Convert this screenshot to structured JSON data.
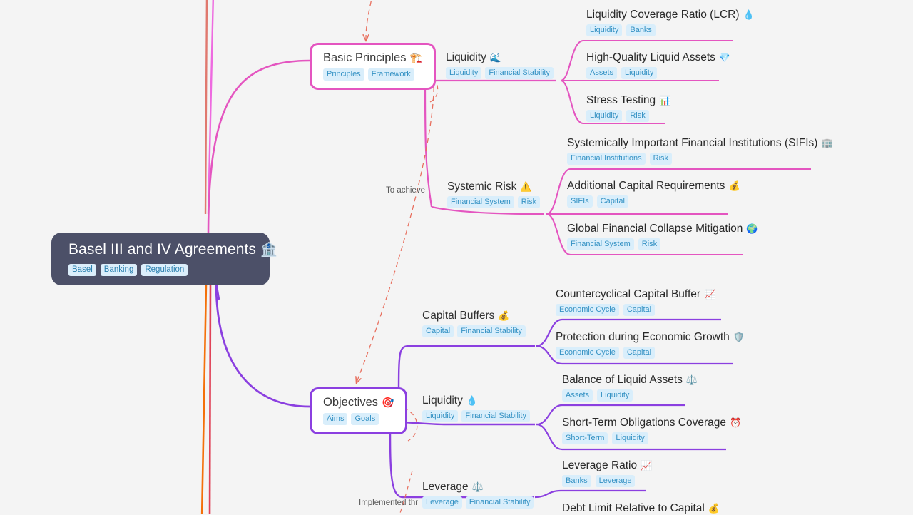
{
  "colors": {
    "background": "#f4f4f4",
    "root_bg": "#4c5068",
    "branch_pink": "#e455c0",
    "branch_purple": "#8b3fe0",
    "tag_bg": "#d9eefb",
    "tag_text": "#3592c4",
    "relation_dashed": "#e8705f",
    "trunk_orange": "#f4700a",
    "trunk_red": "#e04257",
    "trunk_salmon": "#e0786e",
    "trunk_magenta": "#ee6ae0"
  },
  "root": {
    "title": "Basel III and IV Agreements",
    "icon": "bank-icon",
    "emoji": "🏦",
    "tags": [
      "Basel",
      "Banking",
      "Regulation"
    ]
  },
  "relations": [
    {
      "label": "To achieve",
      "name": "relation-label-to-achieve"
    },
    {
      "label": "Implemented thr",
      "name": "relation-label-implemented-through"
    }
  ],
  "branches": [
    {
      "id": "basic-principles",
      "title": "Basic Principles",
      "icon": "construction-crane-icon",
      "emoji": "🏗️",
      "tags": [
        "Principles",
        "Framework"
      ],
      "color": "pink",
      "children": [
        {
          "id": "liquidity-top",
          "title": "Liquidity",
          "icon": "wave-icon",
          "emoji": "🌊",
          "tags": [
            "Liquidity",
            "Financial Stability"
          ],
          "leaves": [
            {
              "title": "Liquidity Coverage Ratio (LCR)",
              "icon": "droplet-icon",
              "emoji": "💧",
              "tags": [
                "Liquidity",
                "Banks"
              ]
            },
            {
              "title": "High-Quality Liquid Assets",
              "icon": "gem-icon",
              "emoji": "💎",
              "tags": [
                "Assets",
                "Liquidity"
              ]
            },
            {
              "title": "Stress Testing",
              "icon": "bar-chart-icon",
              "emoji": "📊",
              "tags": [
                "Liquidity",
                "Risk"
              ]
            }
          ]
        },
        {
          "id": "systemic-risk",
          "title": "Systemic Risk",
          "icon": "warning-icon",
          "emoji": "⚠️",
          "tags": [
            "Financial System",
            "Risk"
          ],
          "leaves": [
            {
              "title": "Systemically Important Financial Institutions (SIFIs)",
              "icon": "office-building-icon",
              "emoji": "🏢",
              "tags": [
                "Financial Institutions",
                "Risk"
              ]
            },
            {
              "title": "Additional Capital Requirements",
              "icon": "money-bag-icon",
              "emoji": "💰",
              "tags": [
                "SIFIs",
                "Capital"
              ]
            },
            {
              "title": "Global Financial Collapse Mitigation",
              "icon": "globe-icon",
              "emoji": "🌍",
              "tags": [
                "Financial System",
                "Risk"
              ]
            }
          ]
        }
      ]
    },
    {
      "id": "objectives",
      "title": "Objectives",
      "icon": "target-icon",
      "emoji": "🎯",
      "tags": [
        "Aims",
        "Goals"
      ],
      "color": "purple",
      "children": [
        {
          "id": "capital-buffers",
          "title": "Capital Buffers",
          "icon": "money-bag-icon",
          "emoji": "💰",
          "tags": [
            "Capital",
            "Financial Stability"
          ],
          "leaves": [
            {
              "title": "Countercyclical Capital Buffer",
              "icon": "chart-increasing-icon",
              "emoji": "📈",
              "tags": [
                "Economic Cycle",
                "Capital"
              ]
            },
            {
              "title": "Protection during Economic Growth",
              "icon": "shield-icon",
              "emoji": "🛡️",
              "tags": [
                "Economic Cycle",
                "Capital"
              ]
            }
          ]
        },
        {
          "id": "liquidity-bottom",
          "title": "Liquidity",
          "icon": "droplet-icon",
          "emoji": "💧",
          "tags": [
            "Liquidity",
            "Financial Stability"
          ],
          "leaves": [
            {
              "title": "Balance of Liquid Assets",
              "icon": "balance-scale-icon",
              "emoji": "⚖️",
              "tags": [
                "Assets",
                "Liquidity"
              ]
            },
            {
              "title": "Short-Term Obligations Coverage",
              "icon": "alarm-clock-icon",
              "emoji": "⏰",
              "tags": [
                "Short-Term",
                "Liquidity"
              ]
            }
          ]
        },
        {
          "id": "leverage",
          "title": "Leverage",
          "icon": "balance-scale-icon",
          "emoji": "⚖️",
          "tags": [
            "Leverage",
            "Financial Stability"
          ],
          "leaves": [
            {
              "title": "Leverage Ratio",
              "icon": "chart-increasing-icon",
              "emoji": "📈",
              "tags": [
                "Banks",
                "Leverage"
              ]
            },
            {
              "title": "Debt Limit Relative to Capital",
              "icon": "money-bag-icon",
              "emoji": "💰",
              "tags": []
            }
          ]
        }
      ]
    }
  ]
}
